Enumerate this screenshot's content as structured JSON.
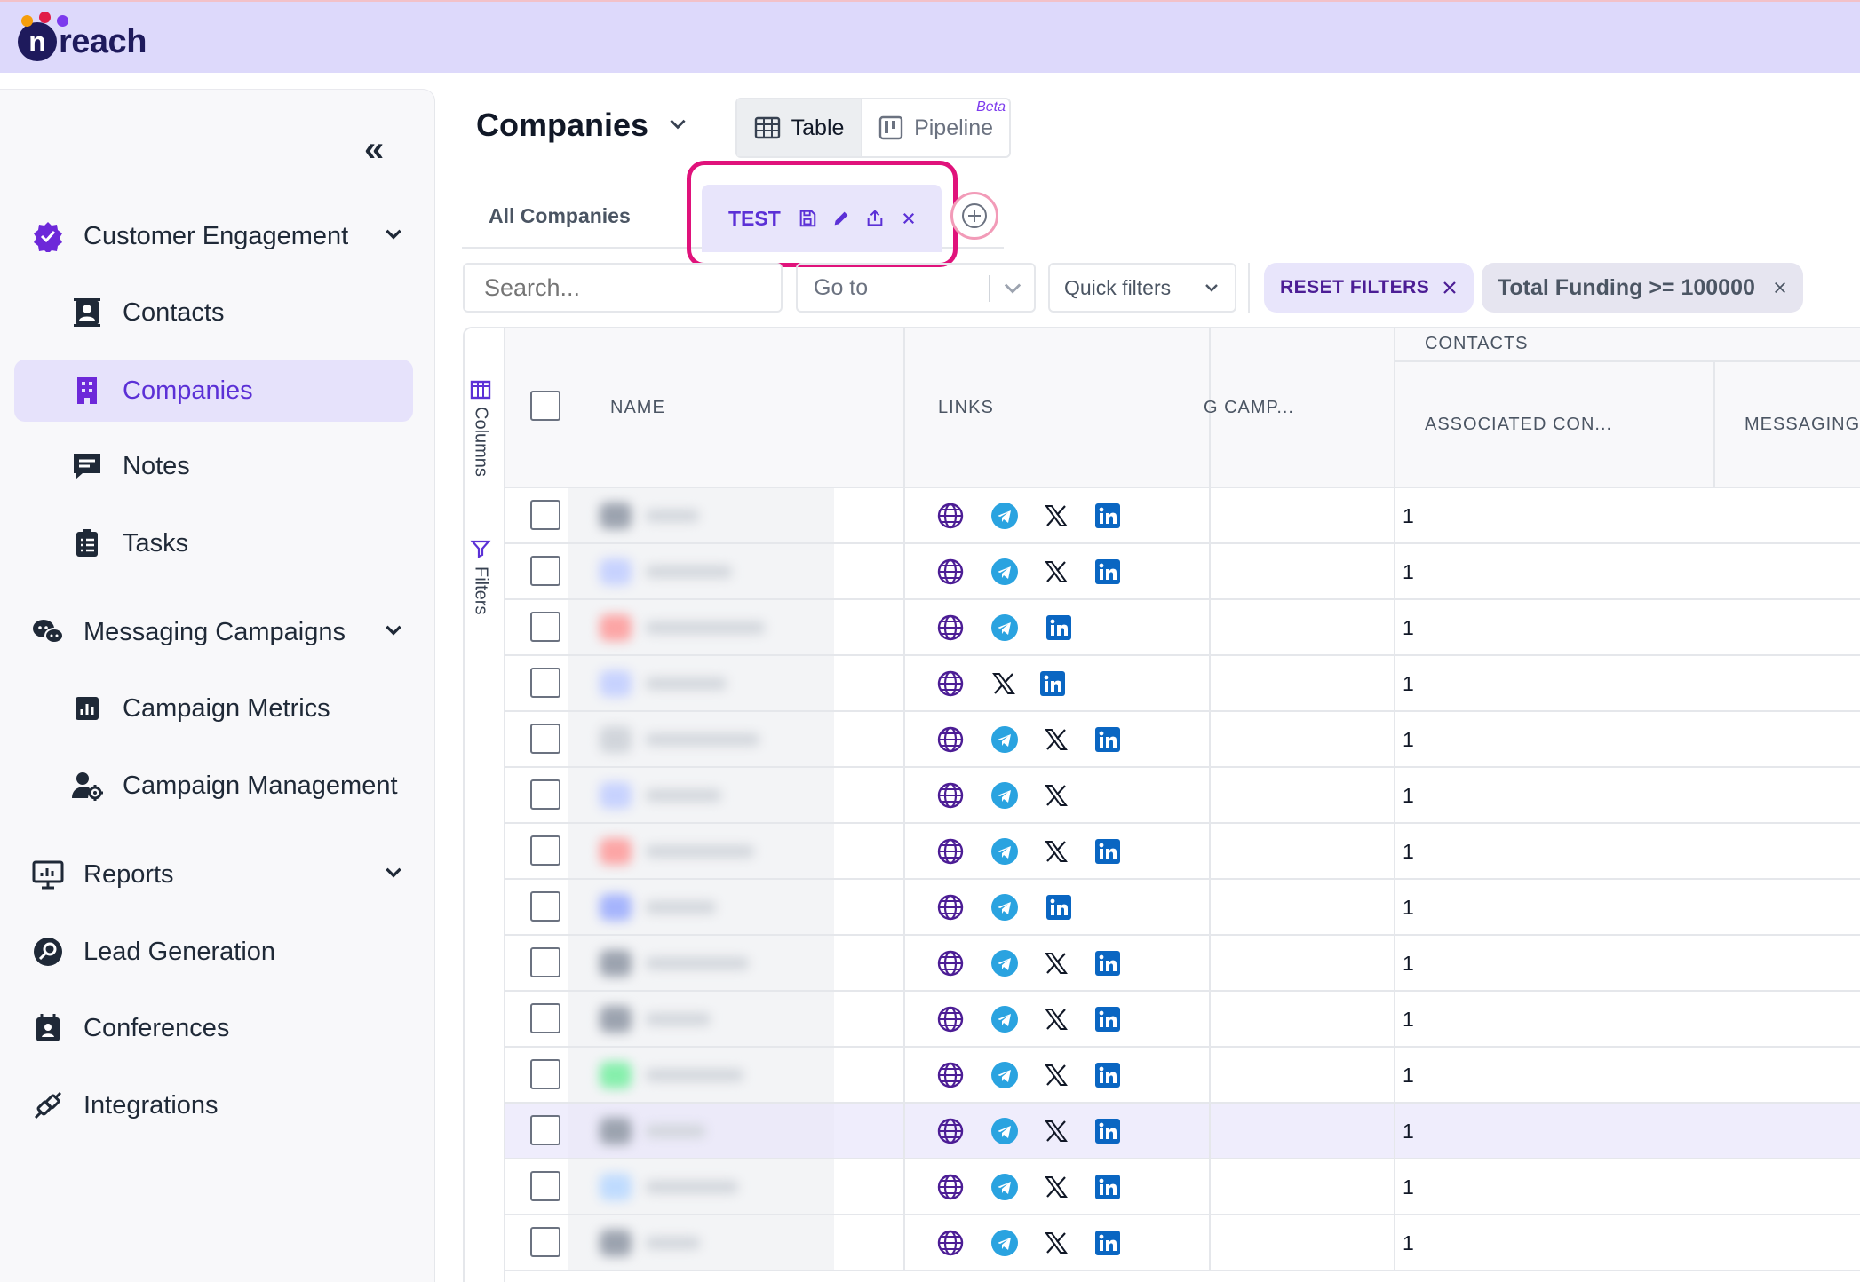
{
  "brand": {
    "name_mark": "n",
    "name_rest": "reach",
    "dot_colors": [
      "#f59e0b",
      "#e11d48",
      "#7c3aed"
    ]
  },
  "sidebar": {
    "collapse_label": "«",
    "items": [
      {
        "label": "Customer Engagement",
        "icon": "verified-badge-icon",
        "has_chevron": true
      },
      {
        "label": "Contacts",
        "icon": "contact-card-icon"
      },
      {
        "label": "Companies",
        "icon": "building-icon",
        "active": true
      },
      {
        "label": "Notes",
        "icon": "note-icon"
      },
      {
        "label": "Tasks",
        "icon": "clipboard-list-icon"
      },
      {
        "label": "Messaging Campaigns",
        "icon": "chat-bubbles-icon",
        "has_chevron": true
      },
      {
        "label": "Campaign Metrics",
        "icon": "bar-chart-icon"
      },
      {
        "label": "Campaign Management",
        "icon": "user-gear-icon"
      },
      {
        "label": "Reports",
        "icon": "monitor-chart-icon",
        "has_chevron": true
      },
      {
        "label": "Lead Generation",
        "icon": "search-circle-icon"
      },
      {
        "label": "Conferences",
        "icon": "calendar-person-icon"
      },
      {
        "label": "Integrations",
        "icon": "plug-icon"
      }
    ]
  },
  "page": {
    "title": "Companies",
    "view_toggle": {
      "table": "Table",
      "pipeline": "Pipeline",
      "beta": "Beta"
    },
    "tabs": {
      "all": "All Companies",
      "active": "TEST"
    },
    "search_placeholder": "Search...",
    "goto_placeholder": "Go to",
    "quick_filters": "Quick filters",
    "reset_filters": "RESET FILTERS",
    "filter_chip": "Total Funding >= 100000"
  },
  "grid": {
    "rail": {
      "columns": "Columns",
      "filters": "Filters"
    },
    "group_header": "CONTACTS",
    "headers": {
      "name": "NAME",
      "links": "LINKS",
      "campaigns": "G CAMP...",
      "associated": "ASSOCIATED CON...",
      "messaging": "MESSAGING C"
    },
    "rows": [
      {
        "links": [
          "web",
          "telegram",
          "x",
          "linkedin"
        ],
        "count": "1",
        "avatar": "#9ca3af"
      },
      {
        "links": [
          "web",
          "telegram",
          "x",
          "linkedin"
        ],
        "count": "1",
        "avatar": "#c7d2fe"
      },
      {
        "links": [
          "web",
          "telegram",
          "linkedin"
        ],
        "count": "1",
        "avatar": "#fca5a5"
      },
      {
        "links": [
          "web",
          "x",
          "linkedin"
        ],
        "count": "1",
        "avatar": "#c7d2fe"
      },
      {
        "links": [
          "web",
          "telegram",
          "x",
          "linkedin"
        ],
        "count": "1",
        "avatar": "#d1d5db"
      },
      {
        "links": [
          "web",
          "telegram",
          "x"
        ],
        "count": "1",
        "avatar": "#c7d2fe"
      },
      {
        "links": [
          "web",
          "telegram",
          "x",
          "linkedin"
        ],
        "count": "1",
        "avatar": "#fca5a5"
      },
      {
        "links": [
          "web",
          "telegram",
          "linkedin"
        ],
        "count": "1",
        "avatar": "#a5b4fc"
      },
      {
        "links": [
          "web",
          "telegram",
          "x",
          "linkedin"
        ],
        "count": "1",
        "avatar": "#9ca3af"
      },
      {
        "links": [
          "web",
          "telegram",
          "x",
          "linkedin"
        ],
        "count": "1",
        "avatar": "#9ca3af"
      },
      {
        "links": [
          "web",
          "telegram",
          "x",
          "linkedin"
        ],
        "count": "1",
        "avatar": "#86efac"
      },
      {
        "links": [
          "web",
          "telegram",
          "x",
          "linkedin"
        ],
        "count": "1",
        "avatar": "#9ca3af",
        "selected": true
      },
      {
        "links": [
          "web",
          "telegram",
          "x",
          "linkedin"
        ],
        "count": "1",
        "avatar": "#bfdbfe"
      },
      {
        "links": [
          "web",
          "telegram",
          "x",
          "linkedin"
        ],
        "count": "1",
        "avatar": "#9ca3af"
      }
    ]
  },
  "colors": {
    "accent": "#5b30d6",
    "highlight": "#e0127b",
    "telegram": "#2aa3e0",
    "linkedin": "#0a66c2"
  }
}
